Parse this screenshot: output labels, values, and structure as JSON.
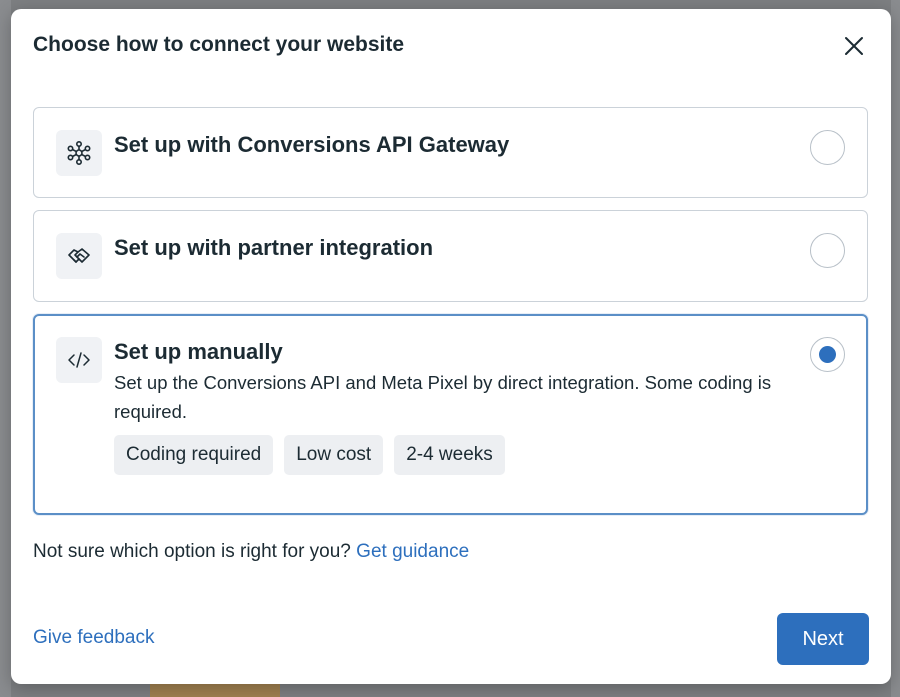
{
  "dialog": {
    "title": "Choose how to connect your website",
    "close_icon": "close-icon"
  },
  "options": [
    {
      "title": "Set up with Conversions API Gateway",
      "icon": "network-nodes-icon",
      "selected": false
    },
    {
      "title": "Set up with partner integration",
      "icon": "handshake-icon",
      "selected": false
    },
    {
      "title": "Set up manually",
      "icon": "code-icon",
      "selected": true,
      "description": "Set up the Conversions API and Meta Pixel by direct integration. Some coding is required.",
      "tags": [
        "Coding required",
        "Low cost",
        "2-4 weeks"
      ]
    }
  ],
  "guidance": {
    "text": "Not sure which option is right for you?",
    "link": "Get guidance"
  },
  "footer": {
    "feedback_link": "Give feedback",
    "next_label": "Next"
  },
  "colors": {
    "accent": "#2d6fbd",
    "selected_border": "#5b8fc7",
    "text": "#1c2b33"
  }
}
